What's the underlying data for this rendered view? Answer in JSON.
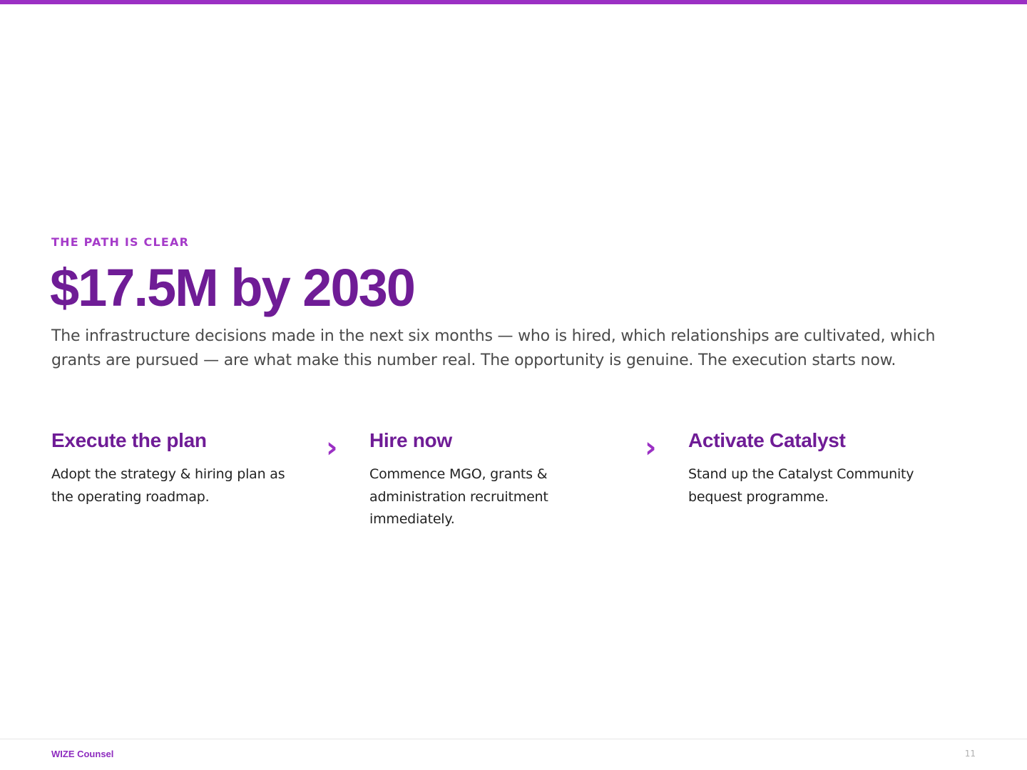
{
  "slide": {
    "eyebrow": "THE PATH IS CLEAR",
    "headline": "$17.5M by 2030",
    "intro": "The infrastructure decisions made in the next six months — who is hired, which relationships are cultivated, which grants are pursued — are what make this number real. The opportunity is genuine. The execution starts now."
  },
  "steps": [
    {
      "title": "Execute the plan",
      "description": "Adopt the strategy & hiring plan as the operating roadmap."
    },
    {
      "title": "Hire now",
      "description": "Commence MGO, grants & administration recruitment immediately."
    },
    {
      "title": "Activate Catalyst",
      "description": "Stand up the Catalyst Community bequest programme."
    }
  ],
  "arrow_glyph": "›",
  "footer": {
    "brand": "WIZE Counsel",
    "page_number": "11"
  },
  "colors": {
    "accent_bar": "#9b30c4",
    "headline": "#6f1c96",
    "eyebrow": "#a53bc9"
  }
}
